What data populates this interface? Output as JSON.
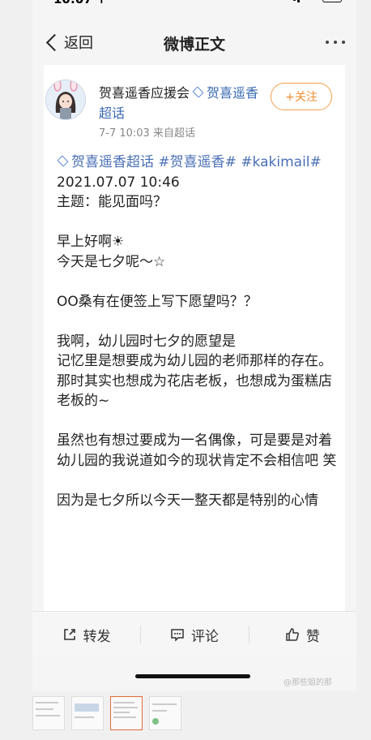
{
  "status": {
    "time": "10:07 ↑"
  },
  "nav": {
    "back_label": "返回",
    "title": "微博正文",
    "more_icon": "more-dots-icon"
  },
  "author": {
    "name": "贺喜遥香应援会",
    "super_link": "贺喜遥香超话",
    "meta": "7-7 10:03  来自超话",
    "follow_label": "+关注"
  },
  "post": {
    "tags": [
      "贺喜遥香超话",
      "#贺喜遥香#",
      "#kakimail#"
    ],
    "lines": [
      "2021.07.07 10:46",
      "主题：能见面吗？",
      "",
      "早上好啊☀",
      "今天是七夕呢～☆",
      "",
      "OO桑有在便签上写下愿望吗？？",
      "",
      "我啊，幼儿园时七夕的愿望是",
      "记忆里是想要成为幼儿园的老师那样的存在。",
      "那时其实也想成为花店老板，也想成为蛋糕店老板的~",
      "",
      "虽然也有想过要成为一名偶像，可是要是对着幼儿园的我说道如今的现状肯定不会相信吧 笑",
      "",
      "因为是七夕所以今天一整天都是特别的心情"
    ]
  },
  "actions": {
    "repost": "转发",
    "comment": "评论",
    "like": "赞"
  },
  "watermark": "@那些姐的那",
  "colors": {
    "link": "#4a6fb5",
    "follow": "#ef8c2f"
  }
}
